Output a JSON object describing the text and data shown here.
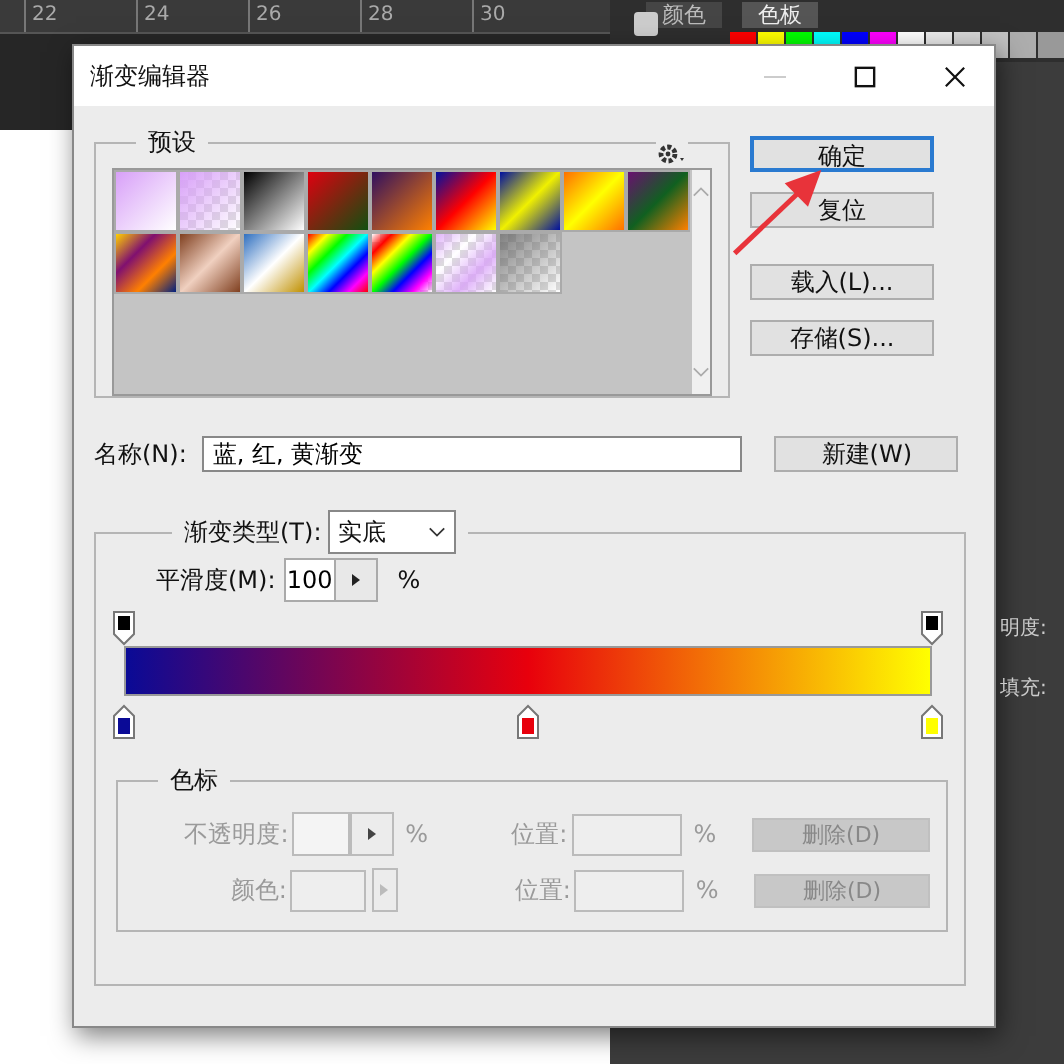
{
  "ruler": {
    "ticks": [
      "22",
      "24",
      "26",
      "28",
      "30"
    ]
  },
  "panel": {
    "tabs": [
      {
        "label": "颜色",
        "selected": false
      },
      {
        "label": "色板",
        "selected": true
      }
    ],
    "swatches": [
      {
        "color": "#ff0000"
      },
      {
        "color": "#ffff00"
      },
      {
        "color": "#00ff00"
      },
      {
        "color": "#00ffff"
      },
      {
        "color": "#0000ff"
      },
      {
        "color": "#ff00ff"
      },
      {
        "color": "#ffffff"
      },
      {
        "color": "#ebebeb"
      },
      {
        "color": "#d6d6d6"
      },
      {
        "color": "#c2c2c2"
      },
      {
        "color": "#adadad"
      },
      {
        "color": "#999999"
      }
    ],
    "labels": [
      "明度:",
      "填充:"
    ]
  },
  "window": {
    "title": "渐变编辑器"
  },
  "presets": {
    "title": "预设"
  },
  "buttons": [
    {
      "label": "确定",
      "selected": true
    },
    {
      "label": "复位",
      "selected": false
    },
    {
      "label": "载入(L)...",
      "selected": false
    },
    {
      "label": "存储(S)...",
      "selected": false
    }
  ],
  "name": {
    "label": "名称(N):",
    "value": "蓝, 红, 黄渐变",
    "button": "新建(W)"
  },
  "gradient": {
    "type_label": "渐变类型(T):",
    "type_value": "实底",
    "smooth_label": "平滑度(M):",
    "smooth_value": "100",
    "smooth_unit": "%",
    "opacity_stops": [
      {
        "level": 0,
        "color": "#000000"
      },
      {
        "level": 1,
        "color": "#000000"
      }
    ],
    "color_stops": [
      {
        "level": 0,
        "color": "#0a0a96"
      },
      {
        "level": 0.5,
        "color": "#e8000c"
      },
      {
        "level": 1,
        "color": "#ffff00"
      }
    ]
  },
  "stops": {
    "title": "色标",
    "rows": [
      {
        "label": "不透明度:",
        "kind": "stepper",
        "unit": "%",
        "position_label": "位置:",
        "position_unit": "%",
        "delete": "删除(D)",
        "disabled": true
      },
      {
        "label": "颜色:",
        "kind": "color",
        "unit": "",
        "position_label": "位置:",
        "position_unit": "%",
        "delete": "删除(D)",
        "disabled": true
      }
    ]
  }
}
